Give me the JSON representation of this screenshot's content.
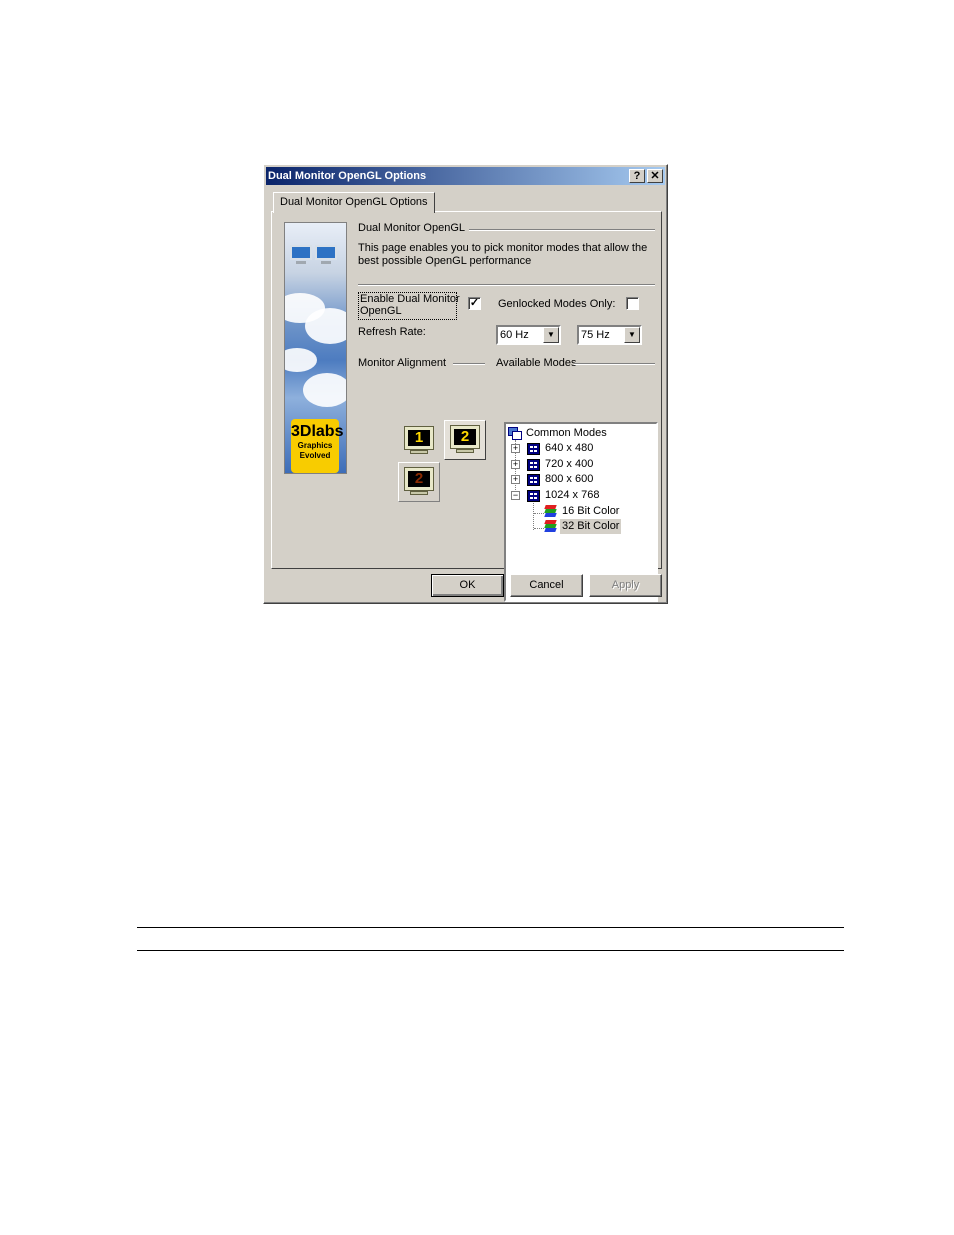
{
  "dialog": {
    "title": "Dual Monitor OpenGL Options",
    "help_label": "?",
    "close_label": "✕",
    "tab_label": "Dual Monitor OpenGL Options",
    "section_title": "Dual Monitor OpenGL",
    "description": "This page enables you to pick monitor modes that allow the best possible OpenGL performance",
    "enable_label": "Enable Dual Monitor OpenGL",
    "enable_checked": true,
    "genlock_label": "Genlocked Modes Only:",
    "genlock_checked": false,
    "refresh_label": "Refresh Rate:",
    "refresh_1": "60 Hz",
    "refresh_2": "75 Hz",
    "alignment_label": "Monitor Alignment",
    "modes_label": "Available Modes",
    "monitors": [
      "1",
      "2",
      "2"
    ],
    "banner": {
      "logo_big": "3Dlabs",
      "logo_small": "Graphics Evolved"
    },
    "tree": {
      "root": "Common Modes",
      "items": [
        "640 x 480",
        "720 x 400",
        "800 x 600",
        "1024 x 768"
      ],
      "sub_items": [
        "16 Bit Color",
        "32 Bit Color"
      ]
    },
    "buttons": {
      "ok": "OK",
      "cancel": "Cancel",
      "apply": "Apply"
    },
    "colors": {
      "title_start": "#0a246a",
      "title_end": "#a6caf0",
      "face": "#d4d0c8",
      "logo": "#f8cc00"
    }
  }
}
